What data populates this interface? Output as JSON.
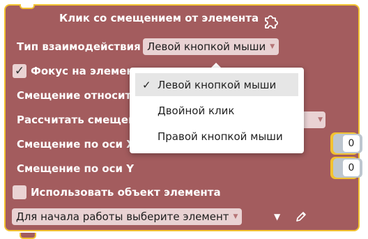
{
  "block": {
    "title": "Клик со смещением от элемента",
    "interaction_type_label": "Тип взаимодействия",
    "interaction_type_value": "Левой кнопкой мыши",
    "focus_label": "Фокус на элемен",
    "focus_checked": true,
    "offset_relative_label": "Смещение относит",
    "calc_offset_label": "Рассчитать смещен",
    "offset_x_label": "Смещение по оси X",
    "offset_x_value": "0",
    "offset_y_label": "Смещение по оси Y",
    "offset_y_value": "0",
    "use_element_label": "Использовать объект элемента",
    "element_select_value": "Для начала работы выберите элемент"
  },
  "menu": {
    "items": [
      {
        "label": "Левой кнопкой мыши",
        "selected": true
      },
      {
        "label": "Двойной клик",
        "selected": false
      },
      {
        "label": "Правой кнопкой мыши",
        "selected": false
      }
    ]
  },
  "colors": {
    "block_bg": "#a35c5e",
    "block_border": "#f2c230",
    "dropdown_bg": "#e9d2d3",
    "connector": "#bdc6cf"
  }
}
